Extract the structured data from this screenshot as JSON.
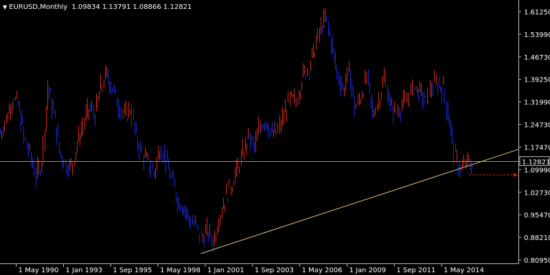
{
  "header": {
    "symbol_timeframe": "EURUSD,Monthly",
    "ohlc": "1.09834 1.13791 1.08866 1.12821"
  },
  "colors": {
    "background": "#000000",
    "axis": "#c0c0c0",
    "text": "#ffffff",
    "bull": "#d22a1e",
    "bear": "#1e2ad6",
    "price_line": "#8a9bb0",
    "trendline": "#f0c87a",
    "arrow": "#d22020"
  },
  "icons": {
    "menu": "triangle-down-icon",
    "arrow": "dashed-arrow-right-icon"
  },
  "chart_data": {
    "type": "line",
    "title": "EURUSD,Monthly",
    "ohlc_last": {
      "open": 1.09834,
      "high": 1.13791,
      "low": 1.08866,
      "close": 1.12821
    },
    "current_price_label": "1.12821",
    "current_price": 1.12821,
    "y_ticks": [
      "1.61250",
      "1.53990",
      "1.46730",
      "1.39250",
      "1.31990",
      "1.24730",
      "1.17470",
      "1.09990",
      "1.02730",
      "0.95470",
      "0.88210",
      "0.80950"
    ],
    "x_ticks": [
      "1 May 1990",
      "1 Jan 1993",
      "1 Sep 1995",
      "1 May 1998",
      "1 Jan 2001",
      "1 Sep 2003",
      "1 May 2006",
      "1 Jan 2009",
      "1 Sep 2011",
      "1 May 2014"
    ],
    "ylim": [
      0.8095,
      1.6125
    ],
    "xlim": [
      "1989-06",
      "2018-09"
    ],
    "grid": false,
    "series": [
      {
        "x": [
          "1989-06",
          "1989-10",
          "1990-02",
          "1990-06",
          "1990-10",
          "1991-02",
          "1991-06",
          "1991-10",
          "1992-02",
          "1992-06",
          "1992-10",
          "1993-02",
          "1993-06",
          "1993-10",
          "1994-02",
          "1994-06",
          "1994-10",
          "1995-02",
          "1995-06",
          "1995-10",
          "1996-02",
          "1996-06",
          "1996-10",
          "1997-02",
          "1997-06",
          "1997-10",
          "1998-02",
          "1998-06",
          "1998-10",
          "1999-02",
          "1999-06",
          "1999-10",
          "2000-02",
          "2000-06",
          "2000-10",
          "2001-02",
          "2001-06",
          "2001-10",
          "2002-02",
          "2002-06",
          "2002-10",
          "2003-02",
          "2003-06",
          "2003-10",
          "2004-02",
          "2004-06",
          "2004-10",
          "2005-02",
          "2005-06",
          "2005-10",
          "2006-02",
          "2006-06",
          "2006-10",
          "2007-02",
          "2007-06",
          "2007-10",
          "2008-02",
          "2008-06",
          "2008-10",
          "2009-02",
          "2009-06",
          "2009-10",
          "2010-02",
          "2010-06",
          "2010-10",
          "2011-02",
          "2011-06",
          "2011-10",
          "2012-02",
          "2012-06",
          "2012-10",
          "2013-02",
          "2013-06",
          "2013-10",
          "2014-02",
          "2014-06",
          "2014-10",
          "2015-02",
          "2015-06",
          "2015-10",
          "2016-02"
        ],
        "values": [
          1.22,
          1.27,
          1.33,
          1.31,
          1.2,
          1.15,
          1.08,
          1.13,
          1.37,
          1.28,
          1.16,
          1.12,
          1.11,
          1.19,
          1.25,
          1.3,
          1.28,
          1.37,
          1.41,
          1.36,
          1.31,
          1.27,
          1.3,
          1.2,
          1.15,
          1.12,
          1.09,
          1.18,
          1.13,
          1.07,
          1.0,
          0.98,
          0.94,
          0.92,
          0.88,
          0.9,
          0.87,
          0.95,
          1.01,
          1.05,
          1.1,
          1.15,
          1.21,
          1.17,
          1.25,
          1.26,
          1.21,
          1.23,
          1.28,
          1.33,
          1.32,
          1.4,
          1.43,
          1.48,
          1.55,
          1.59,
          1.51,
          1.41,
          1.36,
          1.42,
          1.3,
          1.34,
          1.4,
          1.28,
          1.33,
          1.4,
          1.3,
          1.29,
          1.31,
          1.33,
          1.37,
          1.35,
          1.32,
          1.37,
          1.38,
          1.36,
          1.25,
          1.13,
          1.1,
          1.13,
          1.11
        ]
      }
    ],
    "trendline": {
      "x": [
        "2000-10",
        "2018-09"
      ],
      "y": [
        0.83,
        1.167
      ]
    }
  }
}
